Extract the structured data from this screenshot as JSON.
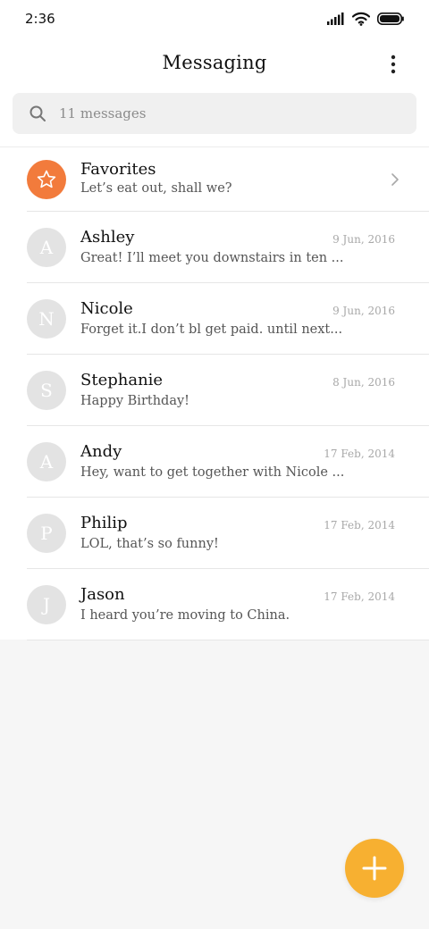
{
  "status_bar": {
    "time": "2:36"
  },
  "header": {
    "title": "Messaging"
  },
  "search": {
    "placeholder": "11 messages"
  },
  "favorites": {
    "name": "Favorites",
    "preview": "Let’s eat out, shall we?"
  },
  "messages": [
    {
      "initial": "A",
      "name": "Ashley",
      "preview": "Great! I’ll meet you downstairs in ten ...",
      "date": "9 Jun, 2016"
    },
    {
      "initial": "N",
      "name": "Nicole",
      "preview": "Forget it.I don’t bl get paid. until next...",
      "date": "9 Jun, 2016"
    },
    {
      "initial": "S",
      "name": "Stephanie",
      "preview": "Happy Birthday!",
      "date": "8 Jun, 2016"
    },
    {
      "initial": "A",
      "name": "Andy",
      "preview": "Hey, want to get together with Nicole ...",
      "date": "17 Feb, 2014"
    },
    {
      "initial": "P",
      "name": "Philip",
      "preview": "LOL, that’s so funny!",
      "date": "17 Feb, 2014"
    },
    {
      "initial": "J",
      "name": "Jason",
      "preview": "I heard you’re moving to China.",
      "date": "17 Feb, 2014"
    }
  ],
  "colors": {
    "favorite_accent": "#f27b3c",
    "fab": "#f7b031",
    "avatar_placeholder": "#e3e3e3"
  },
  "icons": {
    "search": "search-icon",
    "more": "more-vertical-icon",
    "favorite": "star-icon",
    "chevron": "chevron-right-icon",
    "compose": "plus-icon",
    "signal": "signal-icon",
    "wifi": "wifi-icon",
    "battery": "battery-icon"
  }
}
